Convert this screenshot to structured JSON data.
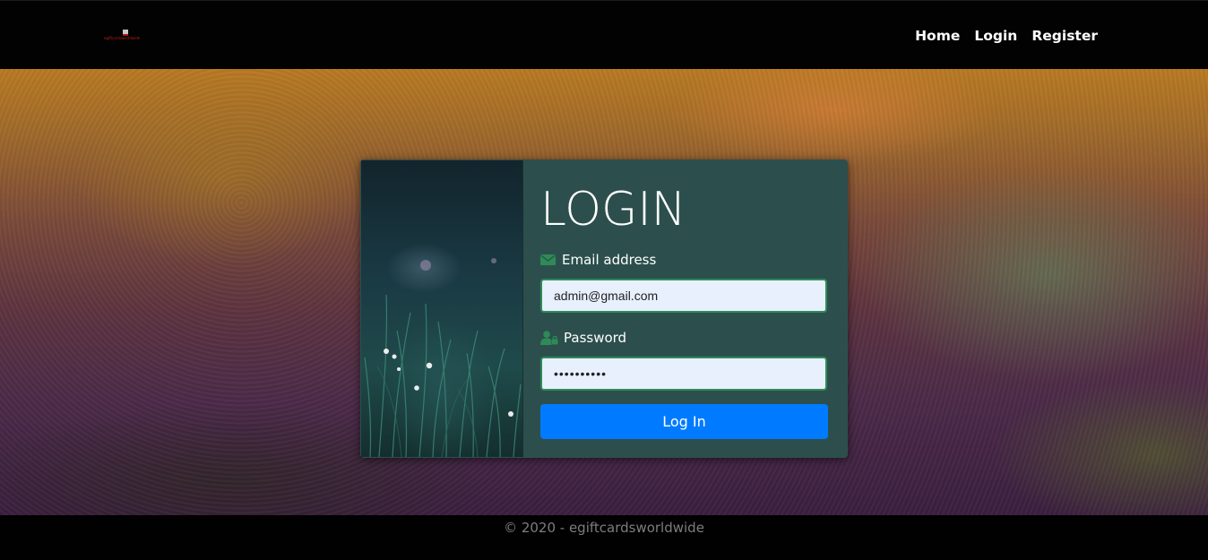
{
  "navbar": {
    "brand_text": "egiftcardsworldwide",
    "links": [
      {
        "label": "Home"
      },
      {
        "label": "Login"
      },
      {
        "label": "Register"
      }
    ]
  },
  "login": {
    "title": "LOGIN",
    "email_label": "Email address",
    "email_value": "admin@gmail.com",
    "password_label": "Password",
    "password_value": "••••••••••",
    "submit_label": "Log In",
    "icons": {
      "email": "envelope-icon",
      "password": "user-lock-icon"
    },
    "colors": {
      "card_bg": "#2c4f4d",
      "button": "#007bff",
      "icon": "#2e8b57",
      "input_bg": "#e8f0fe"
    }
  },
  "footer": {
    "text": "© 2020 - egiftcardsworldwide"
  }
}
